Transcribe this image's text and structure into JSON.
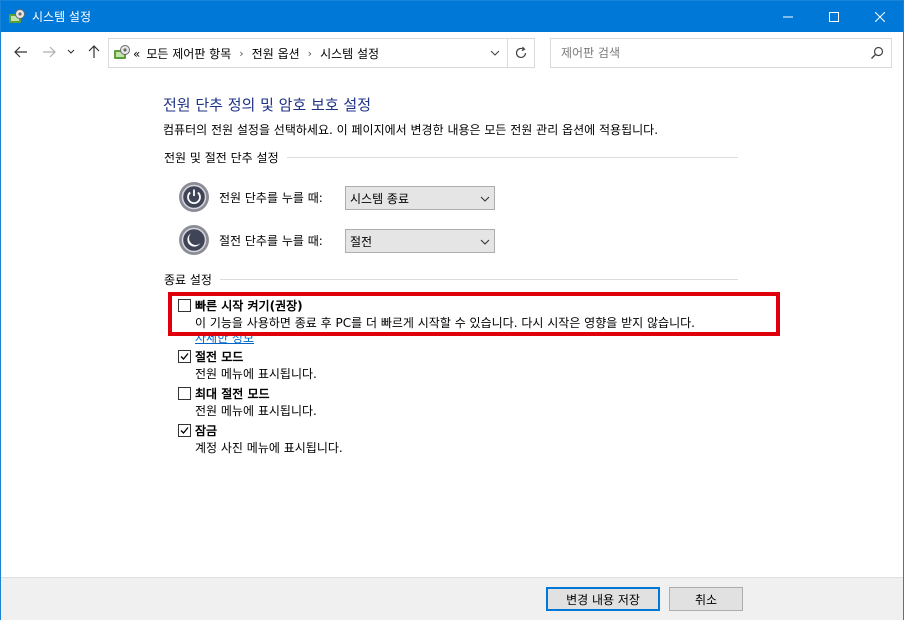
{
  "window": {
    "title": "시스템 설정",
    "accent": "#0078d7"
  },
  "nav": {
    "breadcrumb_prefix": "«",
    "breadcrumbs": [
      "모든 제어판 항목",
      "전원 옵션",
      "시스템 설정"
    ],
    "search_placeholder": "제어판 검색"
  },
  "main": {
    "heading": "전원 단추 정의 및 암호 보호 설정",
    "subtext": "컴퓨터의 전원 설정을 선택하세요. 이 페이지에서 변경한 내용은 모든 전원 관리 옵션에 적용됩니다.",
    "power_section_title": "전원 및 절전 단추 설정",
    "power_button": {
      "label": "전원 단추를 누를 때:",
      "value": "시스템 종료"
    },
    "sleep_button": {
      "label": "절전 단추를 누를 때:",
      "value": "절전"
    },
    "shutdown_section_title": "종료 설정",
    "options": [
      {
        "title": "빠른 시작 켜기(권장)",
        "desc": "이 기능을 사용하면 종료 후 PC를 더 빠르게 시작할 수 있습니다. 다시 시작은 영향을 받지 않습니다.",
        "link": "자세한 정보",
        "checked": false
      },
      {
        "title": "절전 모드",
        "desc": "전원 메뉴에 표시됩니다.",
        "checked": true
      },
      {
        "title": "최대 절전 모드",
        "desc": "전원 메뉴에 표시됩니다.",
        "checked": false
      },
      {
        "title": "잠금",
        "desc": "계정 사진 메뉴에 표시됩니다.",
        "checked": true
      }
    ],
    "highlight_color": "#e0000c"
  },
  "footer": {
    "save_label": "변경 내용 저장",
    "cancel_label": "취소"
  }
}
